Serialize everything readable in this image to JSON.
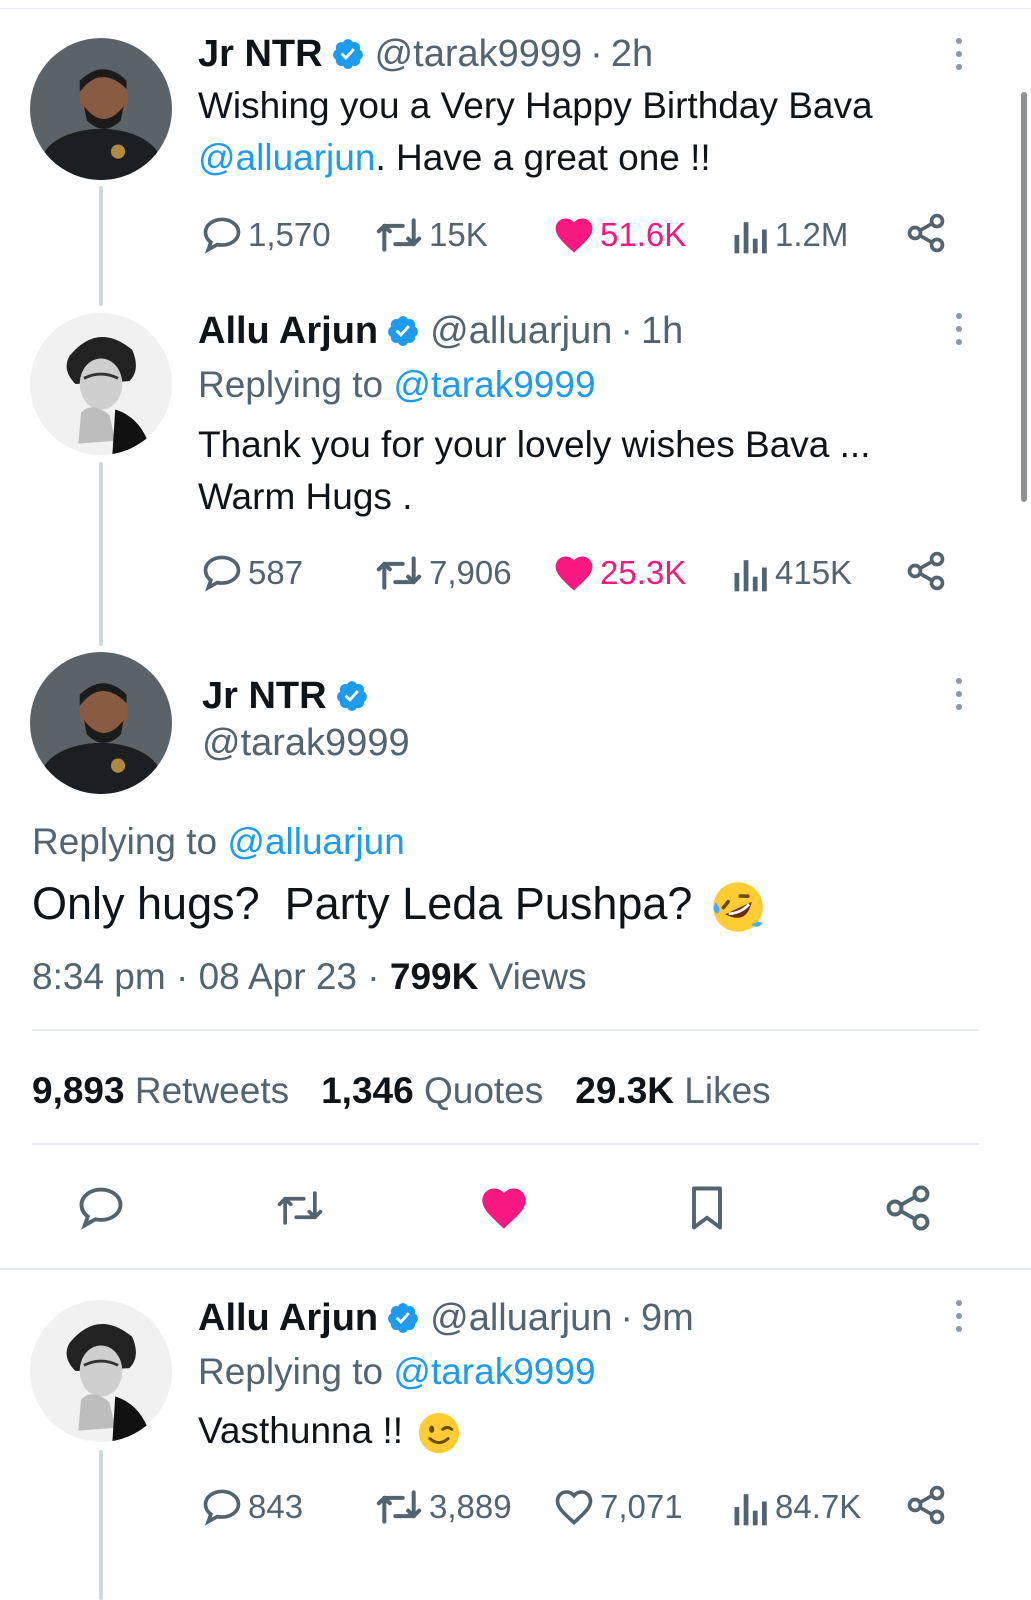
{
  "tweet1": {
    "name": "Jr NTR",
    "handle": "@tarak9999",
    "sep": "·",
    "time": "2h",
    "line1": "Wishing you a Very Happy Birthday Bava",
    "mention": "@alluarjun",
    "line2_rest": ". Have a great one !!",
    "replies": "1,570",
    "retweets": "15K",
    "likes": "51.6K",
    "views": "1.2M"
  },
  "tweet2": {
    "name": "Allu Arjun",
    "handle": "@alluarjun",
    "sep": "·",
    "time": "1h",
    "replying_prefix": "Replying to",
    "replying_to": "@tarak9999",
    "line1": "Thank you for your lovely wishes Bava ...",
    "line2": "Warm Hugs .",
    "replies": "587",
    "retweets": "7,906",
    "likes": "25.3K",
    "views": "415K"
  },
  "main_tweet": {
    "name": "Jr NTR",
    "handle": "@tarak9999",
    "replying_prefix": "Replying to",
    "replying_to": "@alluarjun",
    "text": "Only hugs?  Party Leda Pushpa?",
    "emoji": "rolling-on-floor-laughing",
    "time": "8:34 pm",
    "sep": "·",
    "date": "08 Apr 23",
    "views_count": "799K",
    "views_label": "Views",
    "retweets_count": "9,893",
    "retweets_label": "Retweets",
    "quotes_count": "1,346",
    "quotes_label": "Quotes",
    "likes_count": "29.3K",
    "likes_label": "Likes"
  },
  "tweet4": {
    "name": "Allu Arjun",
    "handle": "@alluarjun",
    "sep": "·",
    "time": "9m",
    "replying_prefix": "Replying to",
    "replying_to": "@tarak9999",
    "text": "Vasthunna !!",
    "emoji": "winking-face",
    "replies": "843",
    "retweets": "3,889",
    "likes": "7,071",
    "views": "84.7K"
  },
  "colors": {
    "accent": "#1d9bf0",
    "like": "#f91880",
    "muted": "#536471",
    "divider": "#e6ecf0"
  }
}
